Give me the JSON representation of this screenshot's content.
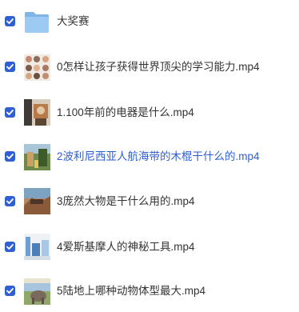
{
  "colors": {
    "accent": "#2f5fd0",
    "text": "#333333",
    "folder": "#8fc0ee"
  },
  "items": [
    {
      "type": "folder",
      "name": "大奖赛",
      "checked": true,
      "icon": "folder-icon"
    },
    {
      "type": "video",
      "name": "0怎样让孩子获得世界顶尖的学习能力.mp4",
      "checked": true,
      "icon": "video-thumbnail"
    },
    {
      "type": "video",
      "name": "1.100年前的电器是什么.mp4",
      "checked": true,
      "icon": "video-thumbnail"
    },
    {
      "type": "video",
      "name": "2波利尼西亚人航海带的木棍干什么的.mp4",
      "checked": true,
      "icon": "video-thumbnail",
      "hovered": true
    },
    {
      "type": "video",
      "name": "3庞然大物是干什么用的.mp4",
      "checked": true,
      "icon": "video-thumbnail"
    },
    {
      "type": "video",
      "name": "4爱斯基摩人的神秘工具.mp4",
      "checked": true,
      "icon": "video-thumbnail"
    },
    {
      "type": "video",
      "name": "5陆地上哪种动物体型最大.mp4",
      "checked": true,
      "icon": "video-thumbnail"
    }
  ]
}
